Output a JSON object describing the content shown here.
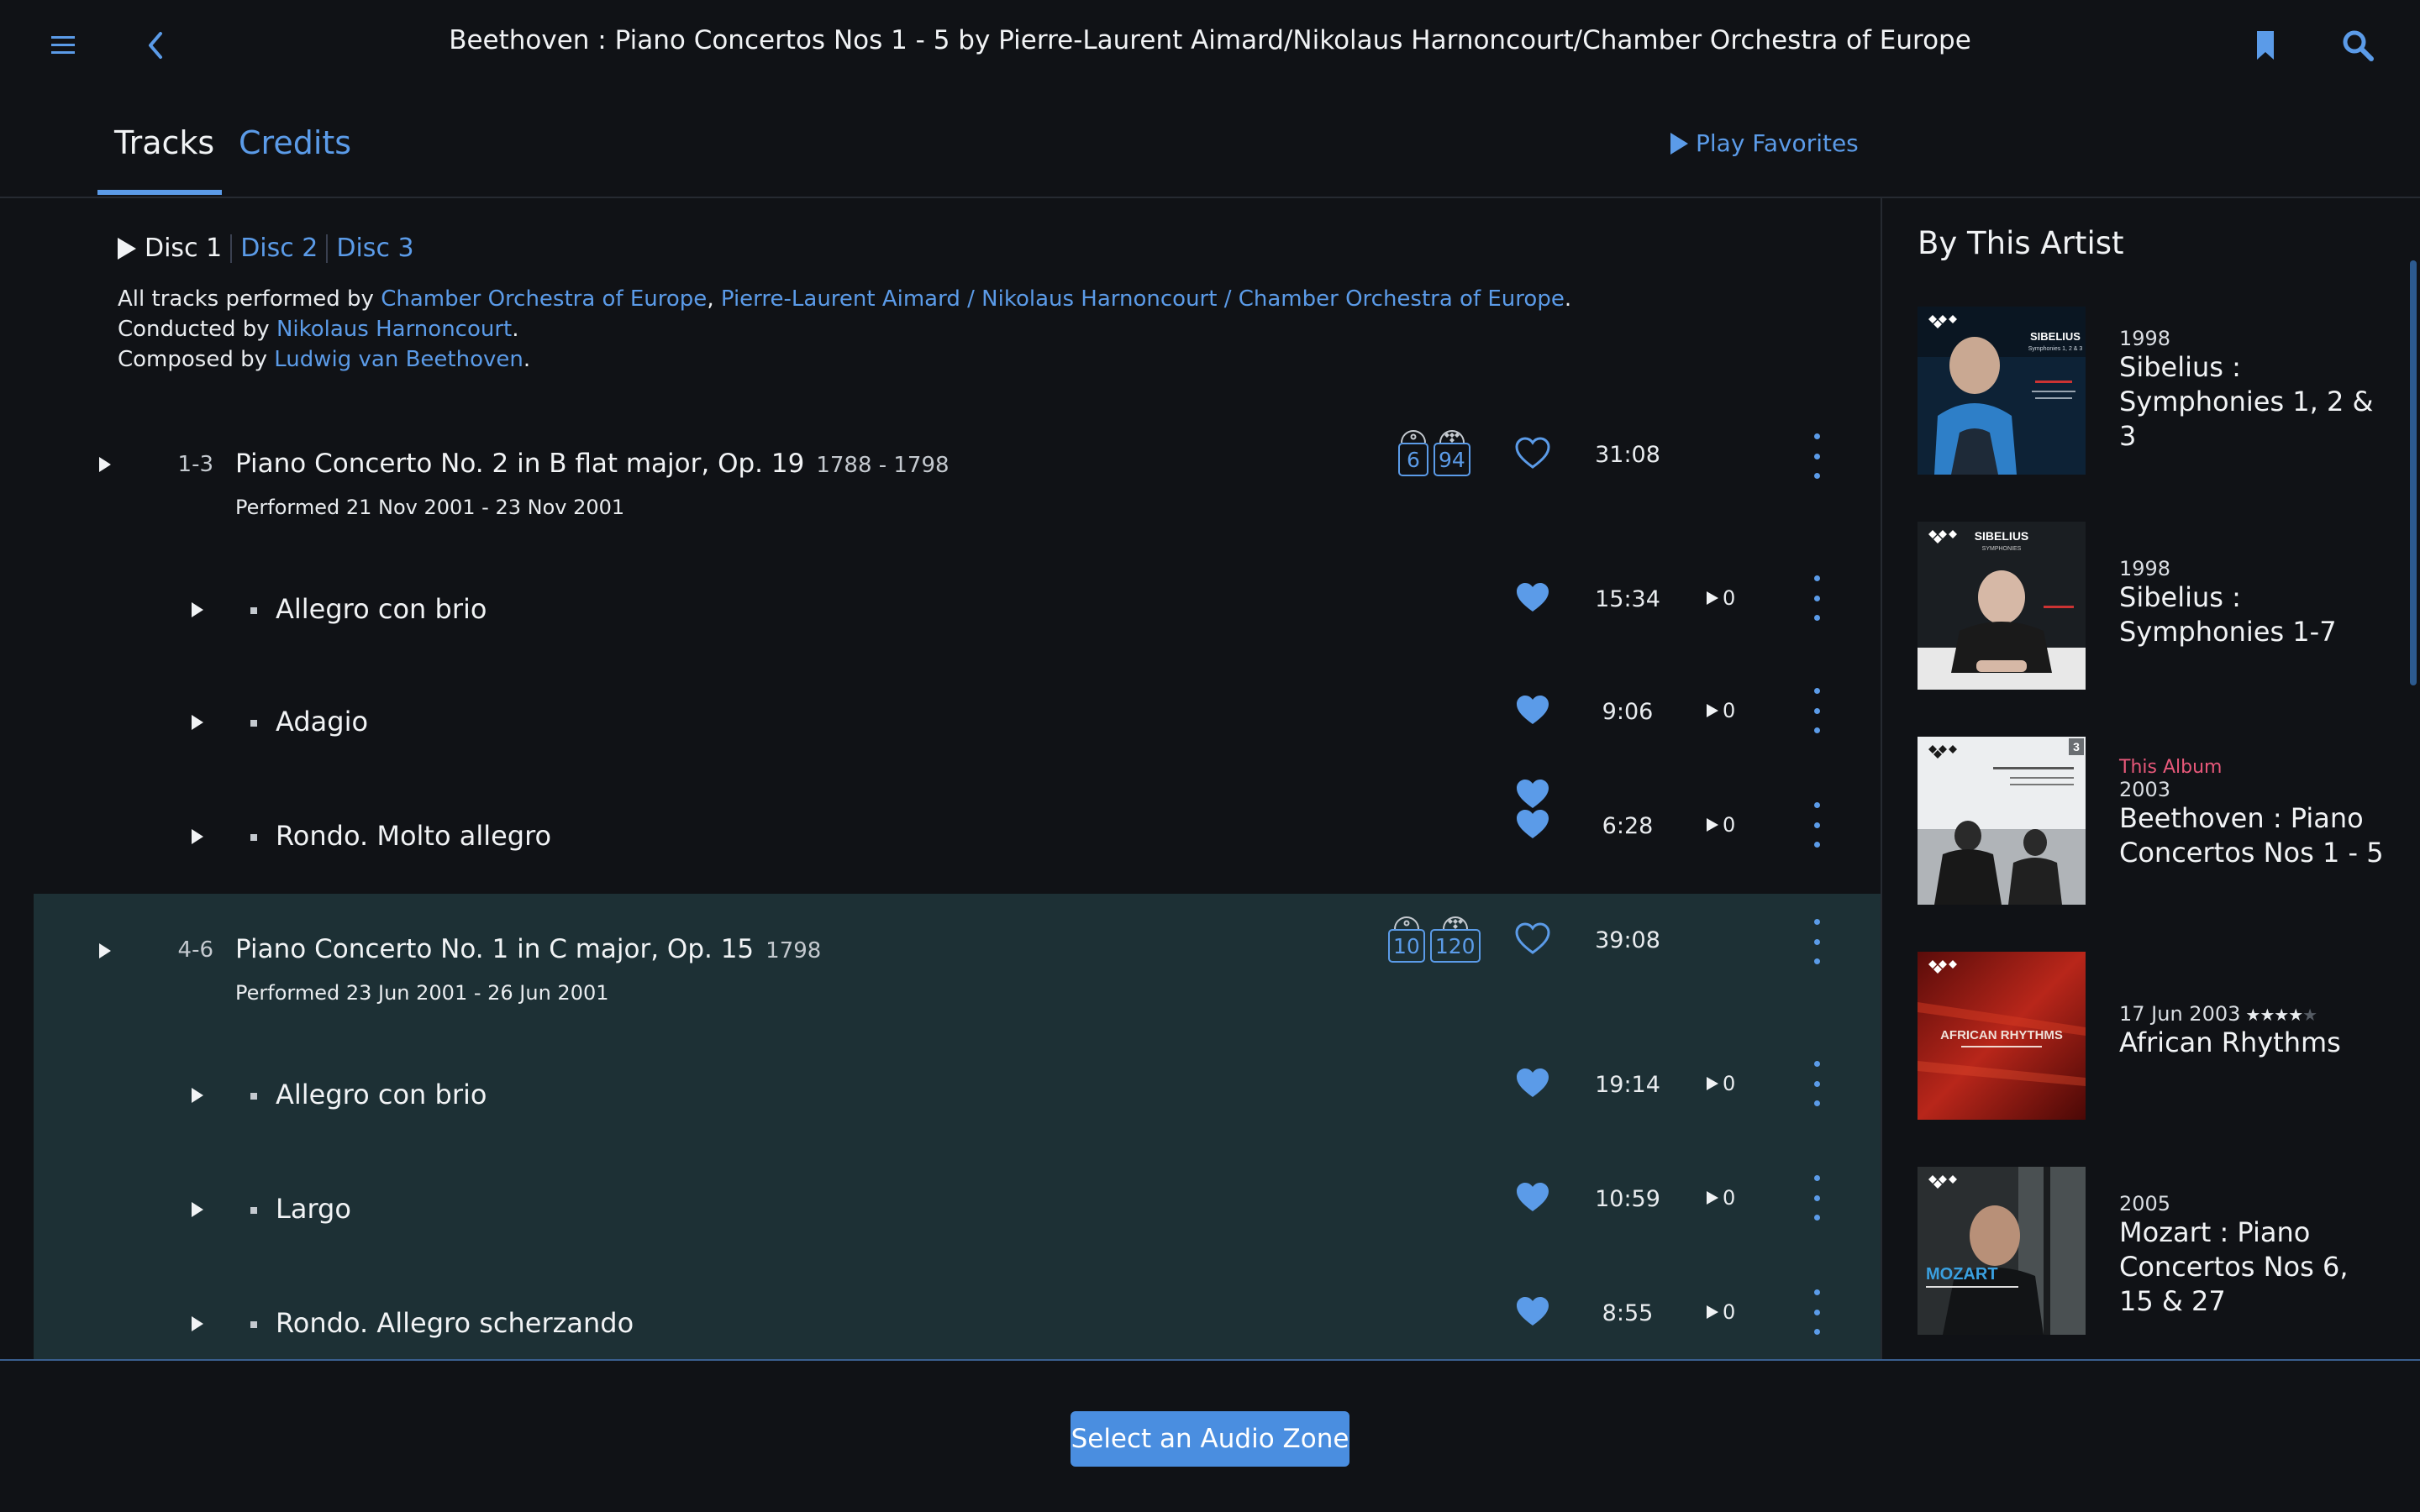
{
  "header": {
    "title": "Beethoven : Piano Concertos Nos 1 - 5 by Pierre-Laurent Aimard/Nikolaus Harnoncourt/Chamber Orchestra of Europe",
    "icons": [
      "menu-icon",
      "back-icon",
      "bookmark-icon",
      "search-icon"
    ]
  },
  "tabs": {
    "tracks": "Tracks",
    "credits": "Credits",
    "active": "Tracks",
    "play_favorites": "Play Favorites"
  },
  "discs": {
    "disc1": "Disc 1",
    "disc2": "Disc 2",
    "disc3": "Disc 3",
    "active": "Disc 1"
  },
  "info": {
    "performed_prefix": "All tracks performed by ",
    "performer1": "Chamber Orchestra of Europe",
    "comma": ", ",
    "performer2": "Pierre-Laurent Aimard / Nikolaus Harnoncourt / Chamber Orchestra of Europe",
    "period": ".",
    "conducted_prefix": "Conducted by ",
    "conductor": "Nikolaus Harnoncourt",
    "composed_prefix": "Composed by ",
    "composer": "Ludwig van Beethoven"
  },
  "works": [
    {
      "num": "1-3",
      "title": "Piano Concerto No. 2 in B flat major, Op. 19",
      "years": "1788 - 1798",
      "performed": "Performed 21 Nov 2001 - 23 Nov 2001",
      "badge_a": "6",
      "badge_b": "94",
      "duration": "31:08",
      "favorite": false,
      "movements": [
        {
          "title": "Allegro con brio",
          "duration": "15:34",
          "plays": "0",
          "favorite": true
        },
        {
          "title": "Adagio",
          "duration": "9:06",
          "plays": "0",
          "favorite": true
        },
        {
          "title": "Rondo. Molto allegro",
          "duration": "6:28",
          "plays": "0",
          "favorite": true
        }
      ]
    },
    {
      "num": "4-6",
      "title": "Piano Concerto No. 1 in C major, Op. 15",
      "years": "1798",
      "performed": "Performed 23 Jun 2001 - 26 Jun 2001",
      "badge_a": "10",
      "badge_b": "120",
      "duration": "39:08",
      "favorite": false,
      "highlighted": true,
      "movements": [
        {
          "title": "Allegro con brio",
          "duration": "19:14",
          "plays": "0",
          "favorite": true
        },
        {
          "title": "Largo",
          "duration": "10:59",
          "plays": "0",
          "favorite": true
        },
        {
          "title": "Rondo. Allegro scherzando",
          "duration": "8:55",
          "plays": "0",
          "favorite": true
        }
      ]
    }
  ],
  "sidebar": {
    "heading": "By This Artist",
    "albums": [
      {
        "year": "1998",
        "title": "Sibelius : Symphonies 1, 2 & 3",
        "cover_text": "SIBELIUS",
        "cover_sub": "Symphonies 1, 2 & 3"
      },
      {
        "year": "1998",
        "title": "Sibelius : Symphonies 1-7",
        "cover_text": "SIBELIUS",
        "cover_sub": "SYMPHONIES"
      },
      {
        "tag": "This Album",
        "year": "2003",
        "title": "Beethoven : Piano Concertos Nos 1 - 5",
        "cover_text": "3"
      },
      {
        "year": "17 Jun 2003",
        "rating": 4,
        "rating_max": 5,
        "title": "African Rhythms",
        "cover_text": "AFRICAN RHYTHMS"
      },
      {
        "year": "2005",
        "title": "Mozart : Piano Concertos Nos 6, 15 & 27",
        "cover_text": "MOZART"
      }
    ]
  },
  "footer": {
    "zone_button": "Select an Audio Zone"
  },
  "colors": {
    "accent": "#5b9be8",
    "background": "#101216",
    "highlight_row": "#1d3035",
    "this_album_tag": "#e8587a"
  }
}
